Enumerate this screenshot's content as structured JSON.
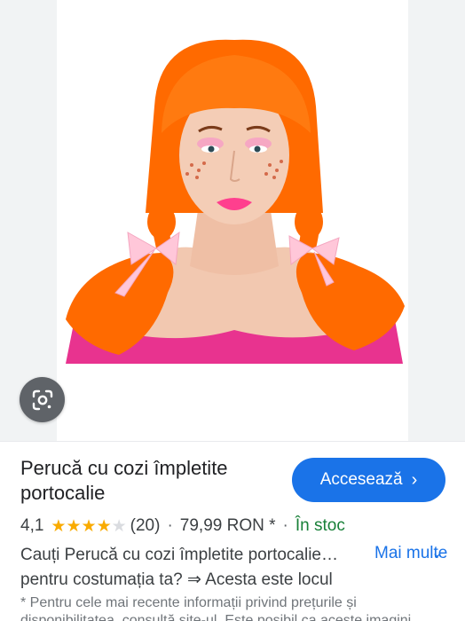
{
  "product": {
    "title": "Perucă cu cozi împletite portocalie",
    "visit_button": "Accesează",
    "rating": "4,1",
    "stars": 4.1,
    "reviews": "(20)",
    "price": "79,99 RON *",
    "stock": "În stoc",
    "description": "Cauți Perucă cu cozi împletite portocalie… pentru costumația ta? ⇒ Acesta este locul",
    "more_label": "Mai multe",
    "disclaimer": "* Pentru cele mai recente informații privind prețurile și disponibilitatea, consultă site-ul. Este posibil ca aceste imagini"
  },
  "icons": {
    "lens": "google-lens-icon",
    "chevron_right": "chevron-right-icon",
    "chevron_down": "chevron-down-icon",
    "star": "star-icon"
  },
  "colors": {
    "accent": "#1a73e8",
    "star": "#f9ab00",
    "stock": "#188038",
    "hair": "#ff6a00"
  }
}
